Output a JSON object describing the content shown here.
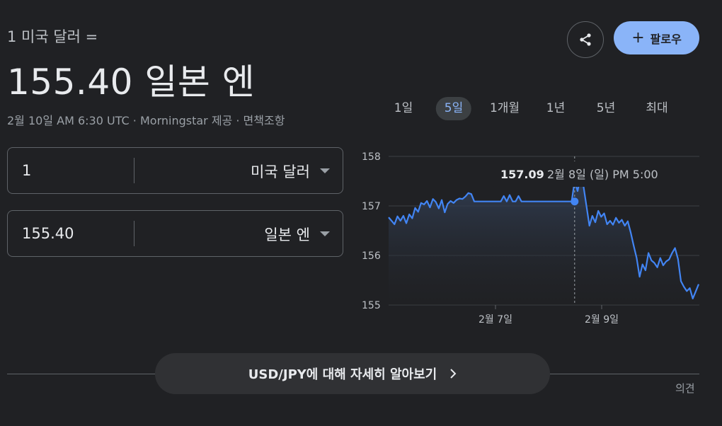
{
  "header": {
    "subtitle": "1 미국 달러 =",
    "result": "155.40 일본 엔",
    "meta": "2월 10일 AM 6:30 UTC · Morningstar 제공 · 면책조항"
  },
  "converter": {
    "from": {
      "value": "1",
      "currency": "미국 달러"
    },
    "to": {
      "value": "155.40",
      "currency": "일본 엔"
    }
  },
  "actions": {
    "follow_label": "팔로우",
    "share_icon": "share-icon"
  },
  "ranges": [
    "1일",
    "5일",
    "1개월",
    "1년",
    "5년",
    "최대"
  ],
  "active_range": "5일",
  "tooltip": {
    "value": "157.09",
    "datetime": "2월 8일 (일) PM 5:00"
  },
  "chart_data": {
    "type": "line",
    "ylim": [
      155,
      158
    ],
    "y_ticks": [
      "158",
      "157",
      "156",
      "155"
    ],
    "x_ticks": [
      "2월 7일",
      "2월 9일"
    ],
    "series": [
      {
        "values": [
          156.77,
          156.7,
          156.63,
          156.79,
          156.7,
          156.8,
          156.65,
          156.83,
          156.75,
          156.96,
          156.88,
          157.06,
          157.03,
          157.1,
          156.97,
          157.14,
          157.08,
          156.95,
          157.12,
          156.87,
          157.04,
          157.1,
          157.06,
          157.12,
          157.15,
          157.14,
          157.19,
          157.26,
          157.24,
          157.09,
          157.09,
          157.09,
          157.09,
          157.09,
          157.09,
          157.09,
          157.09,
          157.09,
          157.09,
          157.2,
          157.09,
          157.22,
          157.09,
          157.09,
          157.2,
          157.09,
          157.09,
          157.09,
          157.09,
          157.09,
          157.09,
          157.09,
          157.09,
          157.09,
          157.09,
          157.09,
          157.09,
          157.09,
          157.09,
          157.09,
          157.09,
          157.09,
          157.09,
          157.5,
          157.3,
          157.6,
          157.4,
          157.0,
          156.6,
          156.8,
          156.67,
          156.9,
          156.78,
          156.85,
          156.63,
          156.7,
          156.62,
          156.76,
          156.66,
          156.72,
          156.6,
          156.69,
          156.46,
          156.2,
          155.95,
          155.57,
          155.82,
          155.7,
          156.05,
          155.9,
          155.85,
          155.76,
          155.95,
          155.8,
          155.88,
          155.92,
          156.05,
          156.15,
          155.93,
          155.48,
          155.37,
          155.28,
          155.34,
          155.13,
          155.27,
          155.42
        ]
      }
    ],
    "highlight_index": 63,
    "highlight_value": 157.09
  },
  "learn_more": "USD/JPY에 대해 자세히 알아보기",
  "feedback": "의견"
}
